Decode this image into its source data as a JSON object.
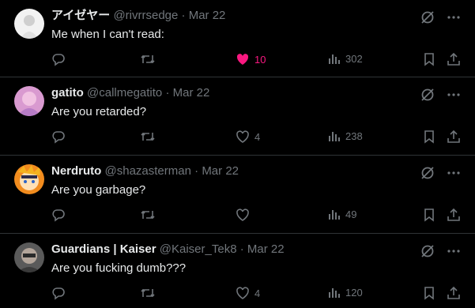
{
  "tweets": [
    {
      "name": "アイゼヤー",
      "handle": "@rivrrsedge",
      "date": "Mar 22",
      "text": "Me when I can't read:",
      "likes": "10",
      "liked": true,
      "views": "302",
      "avatar_colors": [
        "#e9e9e9",
        "#bdbdbd"
      ]
    },
    {
      "name": "gatito",
      "handle": "@callmegatito",
      "date": "Mar 22",
      "text": "Are you retarded?",
      "likes": "4",
      "liked": false,
      "views": "238",
      "avatar_colors": [
        "#e7a6cf",
        "#b97bc4"
      ]
    },
    {
      "name": "Nerdruto",
      "handle": "@shazasterman",
      "date": "Mar 22",
      "text": "Are you garbage?",
      "likes": "",
      "liked": false,
      "views": "49",
      "avatar_colors": [
        "#f28c1e",
        "#ffffff"
      ]
    },
    {
      "name": "Guardians | Kaiser",
      "handle": "@Kaiser_Tek8",
      "date": "Mar 22",
      "text": "Are you fucking dumb???",
      "likes": "4",
      "liked": false,
      "views": "120",
      "avatar_colors": [
        "#8a8a8a",
        "#4a4a4a"
      ]
    }
  ],
  "separator": "·",
  "colors": {
    "like_active": "#f91880",
    "muted": "#71767b",
    "border": "#2f3336"
  }
}
